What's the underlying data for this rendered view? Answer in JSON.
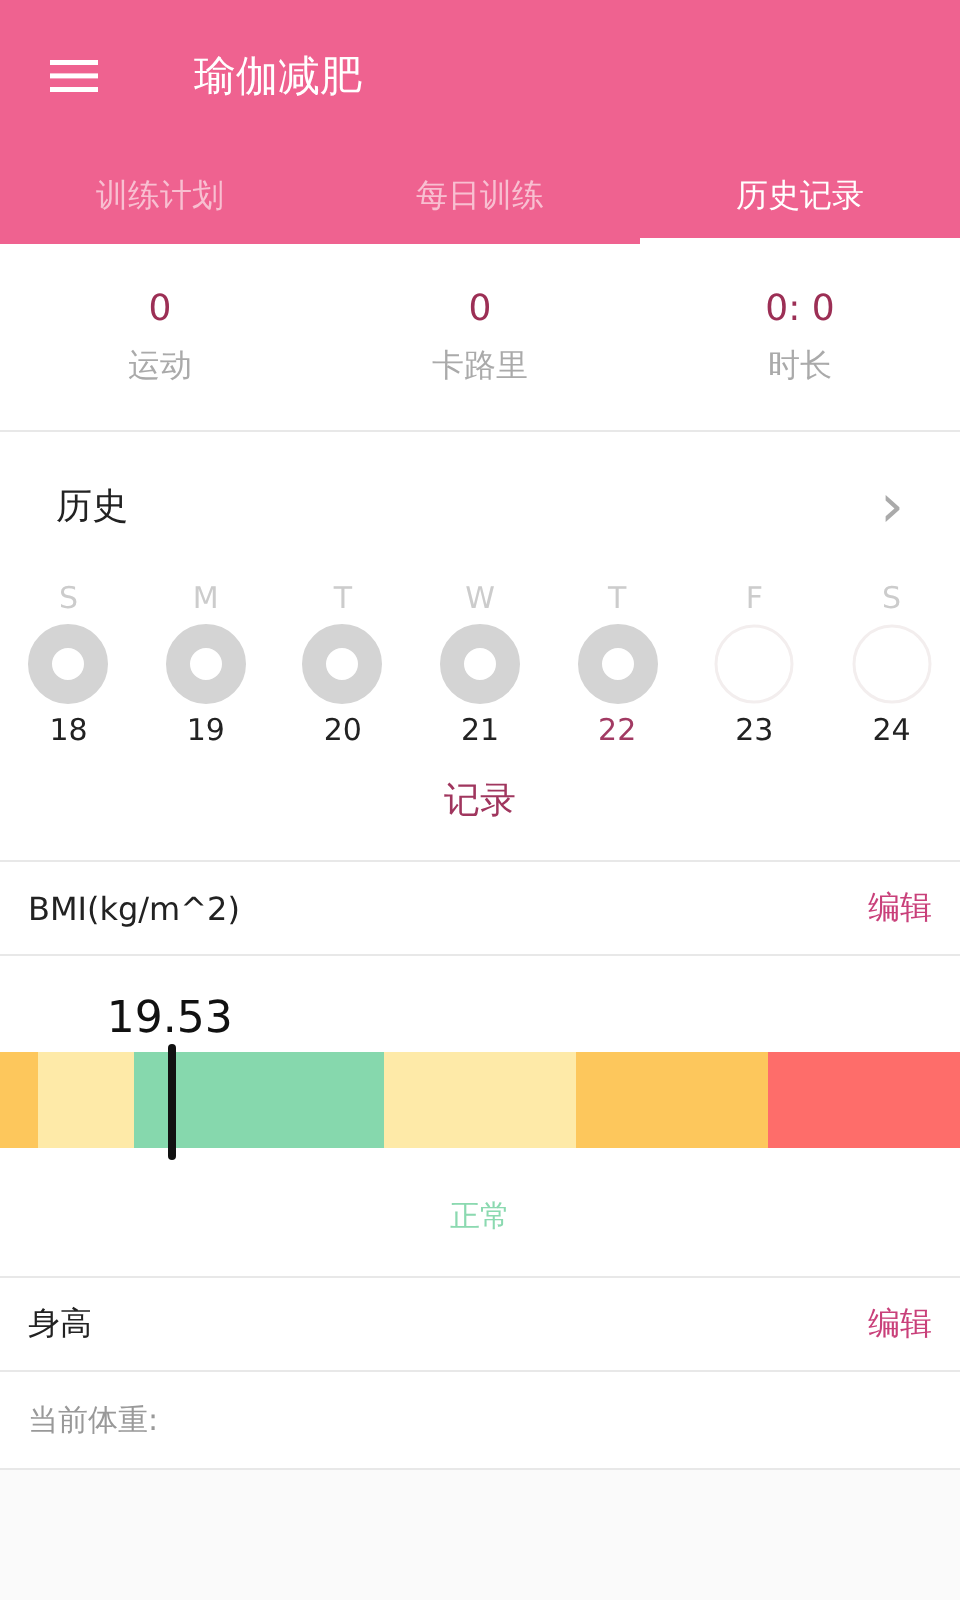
{
  "app_bar": {
    "title": "瑜伽减肥"
  },
  "tabs": [
    {
      "label": "训练计划",
      "selected": false
    },
    {
      "label": "每日训练",
      "selected": false
    },
    {
      "label": "历史记录",
      "selected": true
    }
  ],
  "stats": [
    {
      "value": "0",
      "label": "运动"
    },
    {
      "value": "0",
      "label": "卡路里"
    },
    {
      "value": "0: 0",
      "label": "时长"
    }
  ],
  "history": {
    "title": "历史",
    "chevron": "›",
    "days": [
      {
        "weekday": "S",
        "date": "18",
        "filled": true,
        "today": false
      },
      {
        "weekday": "M",
        "date": "19",
        "filled": true,
        "today": false
      },
      {
        "weekday": "T",
        "date": "20",
        "filled": true,
        "today": false
      },
      {
        "weekday": "W",
        "date": "21",
        "filled": true,
        "today": false
      },
      {
        "weekday": "T",
        "date": "22",
        "filled": true,
        "today": true
      },
      {
        "weekday": "F",
        "date": "23",
        "filled": false,
        "today": false
      },
      {
        "weekday": "S",
        "date": "24",
        "filled": false,
        "today": false
      }
    ],
    "record_button": "记录"
  },
  "bmi": {
    "title": "BMI(kg/m^2)",
    "edit": "编辑",
    "value": "19.53",
    "level": 0.18,
    "status": "正常",
    "segments": [
      {
        "color": "#fdc75c"
      },
      {
        "color": "#feeaa8"
      },
      {
        "color": "#86d8ad"
      },
      {
        "color": "#feeaa8"
      },
      {
        "color": "#fdc75c"
      },
      {
        "color": "#fe6d6a"
      }
    ]
  },
  "height": {
    "title": "身高",
    "edit": "编辑",
    "weight_label": "当前体重:"
  }
}
